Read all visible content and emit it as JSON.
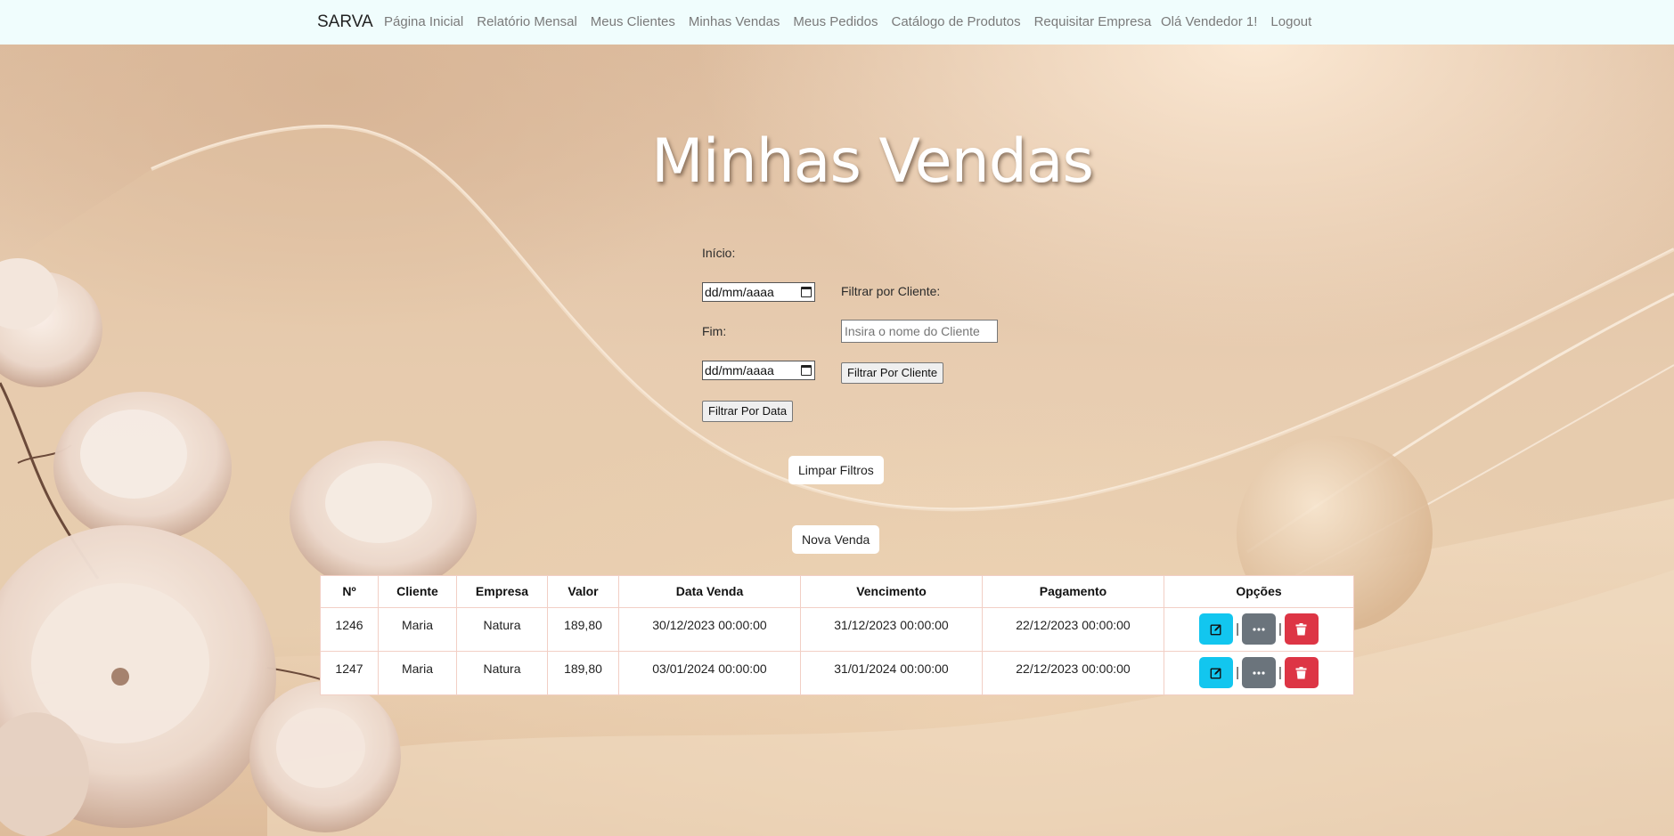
{
  "navbar": {
    "brand": "SARVA",
    "links": [
      {
        "label": "Página Inicial"
      },
      {
        "label": "Relatório Mensal"
      },
      {
        "label": "Meus Clientes"
      },
      {
        "label": "Minhas Vendas"
      },
      {
        "label": "Meus Pedidos"
      },
      {
        "label": "Catálogo de Produtos"
      },
      {
        "label": "Requisitar Empresa"
      }
    ],
    "greeting": "Olá Vendedor 1!",
    "logout": "Logout"
  },
  "page": {
    "title": "Minhas Vendas"
  },
  "filters": {
    "start_label": "Início:",
    "start_value": "dd/mm/aaaa",
    "end_label": "Fim:",
    "end_value": "dd/mm/aaaa",
    "filter_date_button": "Filtrar Por Data",
    "client_label": "Filtrar por Cliente:",
    "client_placeholder": "Insira o nome do Cliente",
    "client_value": "",
    "filter_client_button": "Filtrar Por Cliente",
    "clear_button": "Limpar Filtros",
    "new_sale_button": "Nova Venda"
  },
  "table": {
    "headers": [
      "Nº",
      "Cliente",
      "Empresa",
      "Valor",
      "Data Venda",
      "Vencimento",
      "Pagamento",
      "Opções"
    ],
    "rows": [
      {
        "numero": "1246",
        "cliente": "Maria",
        "empresa": "Natura",
        "valor": "189,80",
        "data_venda": "30/12/2023 00:00:00",
        "vencimento": "31/12/2023 00:00:00",
        "pagamento": "22/12/2023 00:00:00",
        "sep": "|"
      },
      {
        "numero": "1247",
        "cliente": "Maria",
        "empresa": "Natura",
        "valor": "189,80",
        "data_venda": "03/01/2024 00:00:00",
        "vencimento": "31/01/2024 00:00:00",
        "pagamento": "22/12/2023 00:00:00",
        "sep": "|"
      }
    ]
  },
  "colors": {
    "navbar_bg": "#f0fdfd",
    "edit_button": "#12c6ef",
    "more_button": "#6b747c",
    "delete_button": "#dd3545"
  },
  "icons": {
    "edit": "edit-icon",
    "more": "ellipsis-icon",
    "delete": "trash-icon",
    "calendar": "calendar-icon"
  }
}
